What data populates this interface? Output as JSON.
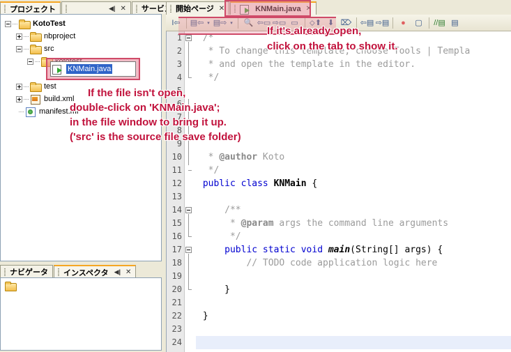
{
  "window": {
    "app": "NetBeans IDE"
  },
  "left_top": {
    "tabs": [
      {
        "label": "プロジェクト",
        "active": true,
        "name": "tab-project"
      },
      {
        "label": "",
        "active": false,
        "name": "tab-files",
        "dock": "◀|",
        "close": "✕"
      },
      {
        "label": "サービス",
        "active": false,
        "name": "tab-services"
      }
    ],
    "tree": [
      {
        "label": "KotoTest",
        "indent": 0,
        "toggle": "minus",
        "icon": "folder",
        "bold": true
      },
      {
        "label": "nbproject",
        "indent": 1,
        "toggle": "plus",
        "icon": "folder",
        "bold": false
      },
      {
        "label": "src",
        "indent": 1,
        "toggle": "minus",
        "icon": "folder",
        "bold": false
      },
      {
        "label": "kototest",
        "indent": 2,
        "toggle": "minus",
        "icon": "folder",
        "bold": false
      },
      {
        "label": "KNMain.java",
        "indent": 3,
        "toggle": "none",
        "icon": "javarun",
        "bold": false,
        "selected": true
      },
      {
        "label": "test",
        "indent": 1,
        "toggle": "plus",
        "icon": "folder",
        "bold": false
      },
      {
        "label": "build.xml",
        "indent": 1,
        "toggle": "plus",
        "icon": "xml",
        "bold": false
      },
      {
        "label": "manifest.mf",
        "indent": 1,
        "toggle": "none",
        "icon": "mf",
        "bold": false
      }
    ]
  },
  "left_bottom": {
    "tabs": [
      {
        "label": "ナビゲータ",
        "active": false,
        "name": "tab-navigator"
      },
      {
        "label": "インスペクタ",
        "active": true,
        "name": "tab-inspector",
        "dock": "◀|",
        "close": "✕"
      }
    ]
  },
  "editor": {
    "tabs": [
      {
        "label": "開始ページ",
        "active": false,
        "close": "✕",
        "name": "tab-start-page"
      },
      {
        "label": "KNMain.java",
        "active": true,
        "close": "✕",
        "name": "tab-knmain-java",
        "icon": "java-run-icon"
      }
    ],
    "toolbar": [
      {
        "name": "back-to-source-icon",
        "glyph": "I⇦"
      },
      {
        "name": "last-edit-icon",
        "glyph": "▤⇦"
      },
      {
        "name": "dropdown-1-icon",
        "glyph": "▾"
      },
      {
        "name": "forward-edit-icon",
        "glyph": "▤⇨"
      },
      {
        "name": "dropdown-2-icon",
        "glyph": "▾"
      },
      {
        "name": "find-selection-icon",
        "glyph": "🔍"
      },
      {
        "name": "find-previous-icon",
        "glyph": "⇦▭"
      },
      {
        "name": "find-next-icon",
        "glyph": "⇨▭"
      },
      {
        "name": "toggle-highlight-icon",
        "glyph": "▭"
      },
      {
        "name": "previous-bookmark-icon",
        "glyph": "⬦⬆"
      },
      {
        "name": "next-bookmark-icon",
        "glyph": "⬇"
      },
      {
        "name": "toggle-bookmark-icon",
        "glyph": "⌦"
      },
      {
        "name": "shift-left-icon",
        "glyph": "⇦▤"
      },
      {
        "name": "shift-right-icon",
        "glyph": "⇨▤"
      },
      {
        "name": "toggle-breakpoint-icon",
        "glyph": "●"
      },
      {
        "name": "stop-icon",
        "glyph": "▢"
      },
      {
        "name": "comment-icon",
        "glyph": "//▤"
      },
      {
        "name": "uncomment-icon",
        "glyph": "▤"
      }
    ],
    "gutter_lines": [
      "1",
      "2",
      "3",
      "4",
      "5",
      "6",
      "7",
      "8",
      "9",
      "10",
      "11",
      "12",
      "13",
      "14",
      "15",
      "16",
      "17",
      "18",
      "19",
      "20",
      "21",
      "22",
      "23",
      "24"
    ],
    "code": [
      {
        "n": 1,
        "segs": [
          {
            "t": " /*",
            "c": "cmt"
          }
        ]
      },
      {
        "n": 2,
        "segs": [
          {
            "t": "  * To change this template, choose Tools | Templa",
            "c": "cmt"
          }
        ]
      },
      {
        "n": 3,
        "segs": [
          {
            "t": "  * and open the template in the editor.",
            "c": "cmt"
          }
        ]
      },
      {
        "n": 4,
        "segs": [
          {
            "t": "  */",
            "c": "cmt"
          }
        ]
      },
      {
        "n": 5,
        "segs": [
          {
            "t": "",
            "c": "cmt"
          }
        ]
      },
      {
        "n": 6,
        "segs": [
          {
            "t": "",
            "c": "cmt"
          }
        ]
      },
      {
        "n": 7,
        "segs": [
          {
            "t": "",
            "c": "cmt"
          }
        ]
      },
      {
        "n": 8,
        "segs": [
          {
            "t": "",
            "c": "cmt"
          }
        ]
      },
      {
        "n": 9,
        "segs": [
          {
            "t": "",
            "c": "cmt"
          }
        ]
      },
      {
        "n": 10,
        "segs": [
          {
            "t": "  * ",
            "c": "cmt"
          },
          {
            "t": "@author",
            "c": "cmtb"
          },
          {
            "t": " Koto",
            "c": "cmt"
          }
        ]
      },
      {
        "n": 11,
        "segs": [
          {
            "t": "  */",
            "c": "cmt"
          }
        ]
      },
      {
        "n": 12,
        "segs": [
          {
            "t": " ",
            "c": "plain"
          },
          {
            "t": "public class ",
            "c": "kw"
          },
          {
            "t": "KNMain",
            "c": "id-bold"
          },
          {
            "t": " {",
            "c": "plain"
          }
        ]
      },
      {
        "n": 13,
        "segs": [
          {
            "t": "",
            "c": "plain"
          }
        ]
      },
      {
        "n": 14,
        "segs": [
          {
            "t": "     /**",
            "c": "cmt"
          }
        ]
      },
      {
        "n": 15,
        "segs": [
          {
            "t": "      * ",
            "c": "cmt"
          },
          {
            "t": "@param",
            "c": "cmtb"
          },
          {
            "t": " args the command line arguments",
            "c": "cmt"
          }
        ]
      },
      {
        "n": 16,
        "segs": [
          {
            "t": "      */",
            "c": "cmt"
          }
        ]
      },
      {
        "n": 17,
        "segs": [
          {
            "t": "     ",
            "c": "plain"
          },
          {
            "t": "public static void ",
            "c": "kw"
          },
          {
            "t": "main",
            "c": "it-bold"
          },
          {
            "t": "(String[] args) {",
            "c": "plain"
          }
        ]
      },
      {
        "n": 18,
        "segs": [
          {
            "t": "         // TODO code application logic here",
            "c": "cmt"
          }
        ]
      },
      {
        "n": 19,
        "segs": [
          {
            "t": "",
            "c": "plain"
          }
        ]
      },
      {
        "n": 20,
        "segs": [
          {
            "t": "     }",
            "c": "plain"
          }
        ]
      },
      {
        "n": 21,
        "segs": [
          {
            "t": "",
            "c": "plain"
          }
        ]
      },
      {
        "n": 22,
        "segs": [
          {
            "t": " }",
            "c": "plain"
          }
        ]
      },
      {
        "n": 23,
        "segs": [
          {
            "t": "",
            "c": "plain"
          }
        ]
      },
      {
        "n": 24,
        "segs": [
          {
            "t": "",
            "c": "plain"
          }
        ]
      }
    ]
  },
  "annotations": {
    "top": [
      "If it's already open,",
      "click on the tab to show it."
    ],
    "left": [
      "If the file isn't open,",
      "double-click on 'KNMain.java';",
      "in the file window to bring it up.",
      "('src' is the source file save folder)"
    ]
  },
  "colors": {
    "annotation_red": "#c1123c",
    "highlight_border": "#cf4a68",
    "selection_blue": "#2f64c8",
    "active_tab_orange": "#f5a623",
    "current_line": "#e8eefb"
  }
}
